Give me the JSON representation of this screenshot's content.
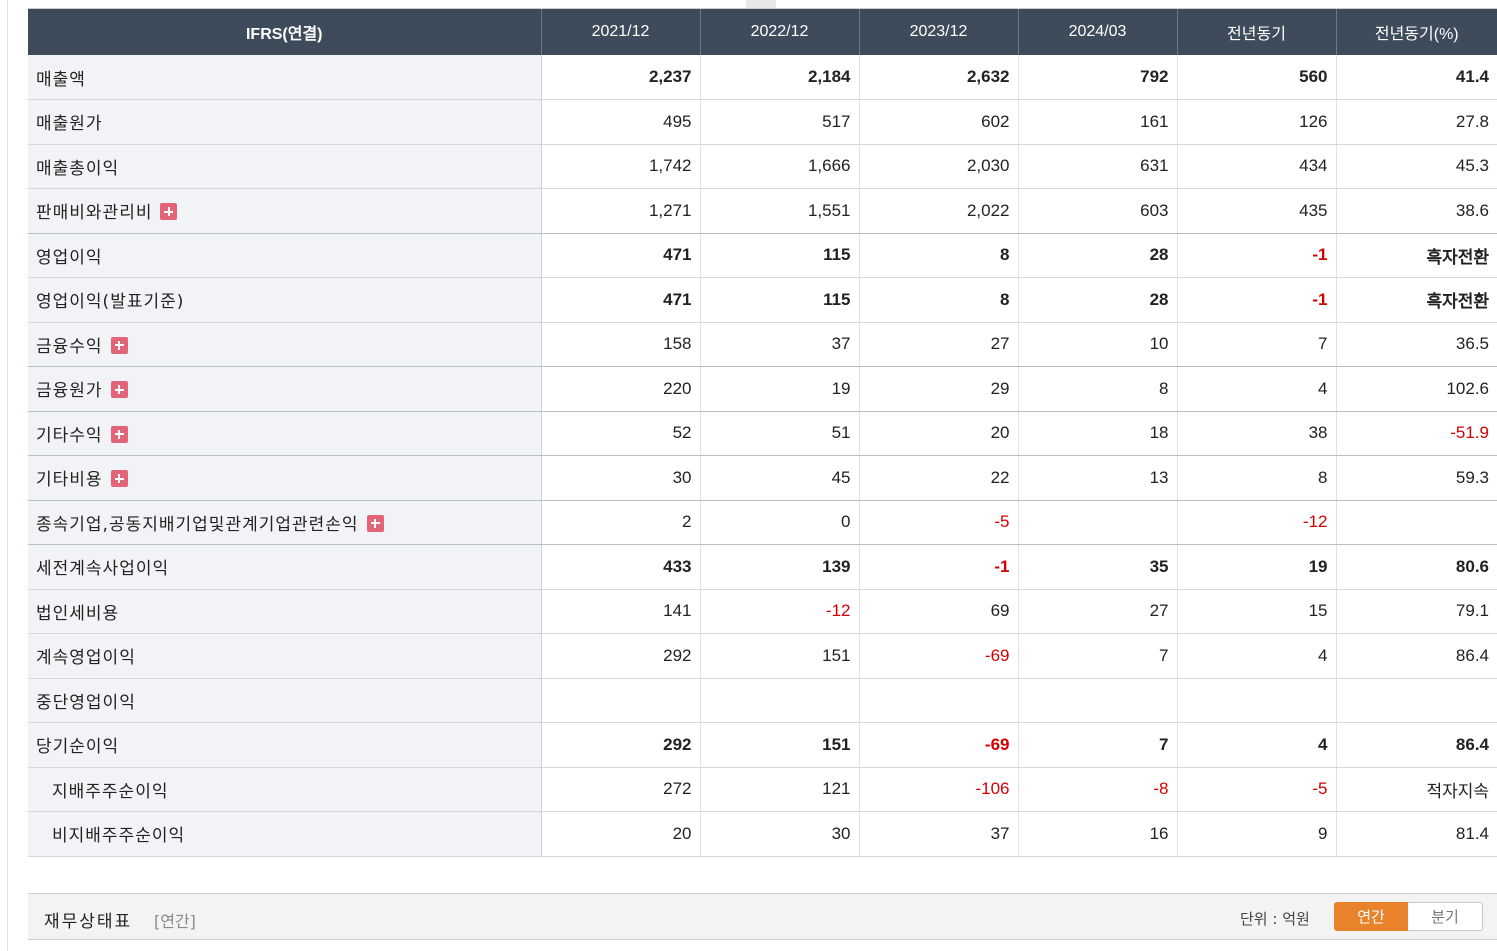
{
  "income_table": {
    "columns": [
      "IFRS(연결)",
      "2021/12",
      "2022/12",
      "2023/12",
      "2024/03",
      "전년동기",
      "전년동기(%)"
    ],
    "rows": [
      {
        "label": "매출액",
        "values": [
          "2,237",
          "2,184",
          "2,632",
          "792",
          "560",
          "41.4"
        ],
        "bold": true,
        "expand": false,
        "sub": false
      },
      {
        "label": "매출원가",
        "values": [
          "495",
          "517",
          "602",
          "161",
          "126",
          "27.8"
        ],
        "bold": false,
        "expand": false,
        "sub": false
      },
      {
        "label": "매출총이익",
        "values": [
          "1,742",
          "1,666",
          "2,030",
          "631",
          "434",
          "45.3"
        ],
        "bold": false,
        "expand": false,
        "sub": false
      },
      {
        "label": "판매비와관리비",
        "values": [
          "1,271",
          "1,551",
          "2,022",
          "603",
          "435",
          "38.6"
        ],
        "bold": false,
        "expand": true,
        "sub": false,
        "group_end": true
      },
      {
        "label": "영업이익",
        "values": [
          "471",
          "115",
          "8",
          "28",
          "-1",
          "흑자전환"
        ],
        "bold": true,
        "expand": false,
        "sub": false
      },
      {
        "label": "영업이익(발표기준)",
        "values": [
          "471",
          "115",
          "8",
          "28",
          "-1",
          "흑자전환"
        ],
        "bold": true,
        "expand": false,
        "sub": false
      },
      {
        "label": "금융수익",
        "values": [
          "158",
          "37",
          "27",
          "10",
          "7",
          "36.5"
        ],
        "bold": false,
        "expand": true,
        "sub": false,
        "group_end": true
      },
      {
        "label": "금융원가",
        "values": [
          "220",
          "19",
          "29",
          "8",
          "4",
          "102.6"
        ],
        "bold": false,
        "expand": true,
        "sub": false,
        "group_end": true
      },
      {
        "label": "기타수익",
        "values": [
          "52",
          "51",
          "20",
          "18",
          "38",
          "-51.9"
        ],
        "bold": false,
        "expand": true,
        "sub": false,
        "group_end": true
      },
      {
        "label": "기타비용",
        "values": [
          "30",
          "45",
          "22",
          "13",
          "8",
          "59.3"
        ],
        "bold": false,
        "expand": true,
        "sub": false,
        "group_end": true
      },
      {
        "label": "종속기업,공동지배기업및관계기업관련손익",
        "values": [
          "2",
          "0",
          "-5",
          "",
          "-12",
          ""
        ],
        "bold": false,
        "expand": true,
        "sub": false,
        "group_end": true
      },
      {
        "label": "세전계속사업이익",
        "values": [
          "433",
          "139",
          "-1",
          "35",
          "19",
          "80.6"
        ],
        "bold": true,
        "expand": false,
        "sub": false
      },
      {
        "label": "법인세비용",
        "values": [
          "141",
          "-12",
          "69",
          "27",
          "15",
          "79.1"
        ],
        "bold": false,
        "expand": false,
        "sub": false
      },
      {
        "label": "계속영업이익",
        "values": [
          "292",
          "151",
          "-69",
          "7",
          "4",
          "86.4"
        ],
        "bold": false,
        "expand": false,
        "sub": false
      },
      {
        "label": "중단영업이익",
        "values": [
          "",
          "",
          "",
          "",
          "",
          ""
        ],
        "bold": false,
        "expand": false,
        "sub": false
      },
      {
        "label": "당기순이익",
        "values": [
          "292",
          "151",
          "-69",
          "7",
          "4",
          "86.4"
        ],
        "bold": true,
        "expand": false,
        "sub": false
      },
      {
        "label": "지배주주순이익",
        "values": [
          "272",
          "121",
          "-106",
          "-8",
          "-5",
          "적자지속"
        ],
        "bold": false,
        "expand": false,
        "sub": true
      },
      {
        "label": "비지배주주순이익",
        "values": [
          "20",
          "30",
          "37",
          "16",
          "9",
          "81.4"
        ],
        "bold": false,
        "expand": false,
        "sub": true
      }
    ]
  },
  "footer": {
    "title": "재무상태표",
    "period": "[연간]",
    "unit": "단위 : 억원",
    "toggle_annual": "연간",
    "toggle_quarter": "분기"
  },
  "colors": {
    "header_bg": "#3e4b5b",
    "negative": "#d40000",
    "accent": "#e8832c",
    "expand_icon": "#e36478"
  }
}
